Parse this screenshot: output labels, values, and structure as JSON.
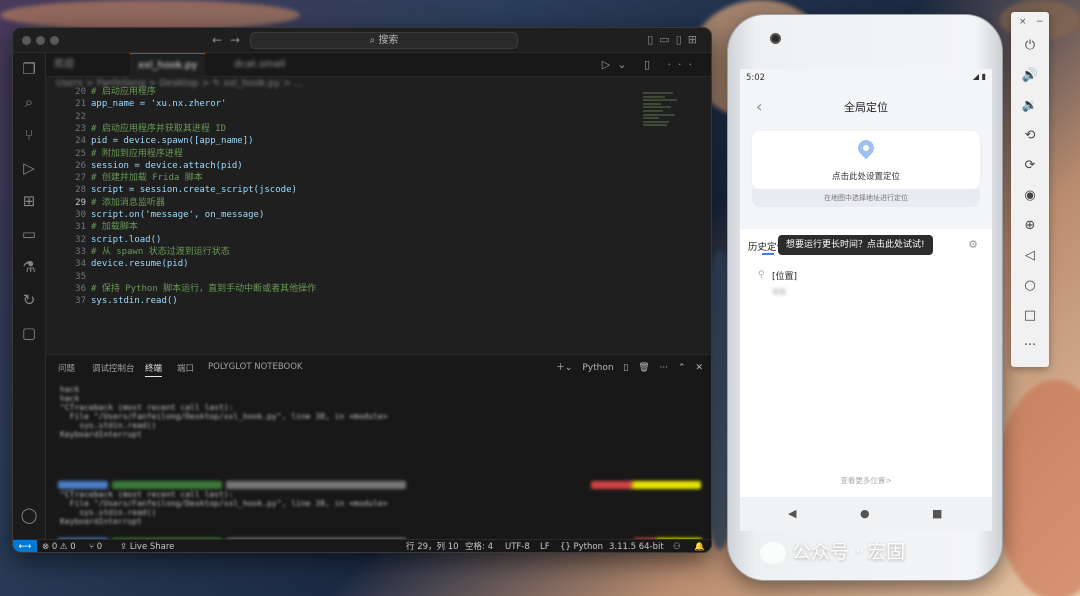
{
  "vscode": {
    "search_placeholder": "⌕ 搜索",
    "tabs": [
      {
        "label": "欢迎"
      },
      {
        "label": "xxl_hook.py"
      },
      {
        "label": "dcat.smali"
      }
    ],
    "breadcrumb": "Users > Fanfeilong > Desktop > ✎ xxl_hook.py > ...",
    "code": [
      {
        "ln": "20",
        "text": "# 启动应用程序",
        "cls": "c-comment"
      },
      {
        "ln": "21",
        "text": "app_name = 'xu.nx.zheror'",
        "cls": "c-var"
      },
      {
        "ln": "22",
        "text": "",
        "cls": "c-op"
      },
      {
        "ln": "23",
        "text": "# 启动应用程序并获取其进程 ID",
        "cls": "c-comment"
      },
      {
        "ln": "24",
        "text": "pid = device.spawn([app_name])",
        "cls": "c-var"
      },
      {
        "ln": "25",
        "text": "# 附加到应用程序进程",
        "cls": "c-comment"
      },
      {
        "ln": "26",
        "text": "session = device.attach(pid)",
        "cls": "c-var"
      },
      {
        "ln": "27",
        "text": "# 创建并加载 Frida 脚本",
        "cls": "c-comment"
      },
      {
        "ln": "28",
        "text": "script = session.create_script(jscode)",
        "cls": "c-var"
      },
      {
        "ln": "29",
        "text": "# 添加消息监听器",
        "cls": "c-comment"
      },
      {
        "ln": "30",
        "text": "script.on('message', on_message)",
        "cls": "c-var"
      },
      {
        "ln": "31",
        "text": "# 加载脚本",
        "cls": "c-comment"
      },
      {
        "ln": "32",
        "text": "script.load()",
        "cls": "c-var"
      },
      {
        "ln": "33",
        "text": "# 从 spawn 状态过渡到运行状态",
        "cls": "c-comment"
      },
      {
        "ln": "34",
        "text": "device.resume(pid)",
        "cls": "c-var"
      },
      {
        "ln": "35",
        "text": "",
        "cls": "c-op"
      },
      {
        "ln": "36",
        "text": "# 保持 Python 脚本运行，直到手动中断或者其他操作",
        "cls": "c-comment"
      },
      {
        "ln": "37",
        "text": "sys.stdin.read()",
        "cls": "c-var"
      }
    ],
    "current_line": "29",
    "panel_tabs": [
      "问题",
      "调试控制台",
      "终端",
      "端口",
      "POLYGLOT NOTEBOOK"
    ],
    "panel_active": "终端",
    "panel_shell": "Python",
    "terminal_last": "hack",
    "terminal_cursor": "▯",
    "status": {
      "errors": "⊗ 0 ⚠ 0",
      "ports": "⑂ 0",
      "live_share": "Live Share",
      "position": "行 29，列 10",
      "spaces": "空格: 4",
      "encoding": "UTF-8",
      "eol": "LF",
      "language": "{} Python",
      "interpreter": "3.11.5 64-bit"
    }
  },
  "phone": {
    "time": "5:02",
    "title": "全局定位",
    "set_location": "点击此处设置定位",
    "choose_on_map": "在地图中选择地址进行定位",
    "history_label": "历史定位",
    "tooltip": "想要运行更长时间？点击此处试试!",
    "item_title": "[位置]",
    "item_sub": "美国",
    "more": "查看更多位置>"
  },
  "watermark": "公众号 · 宏固"
}
